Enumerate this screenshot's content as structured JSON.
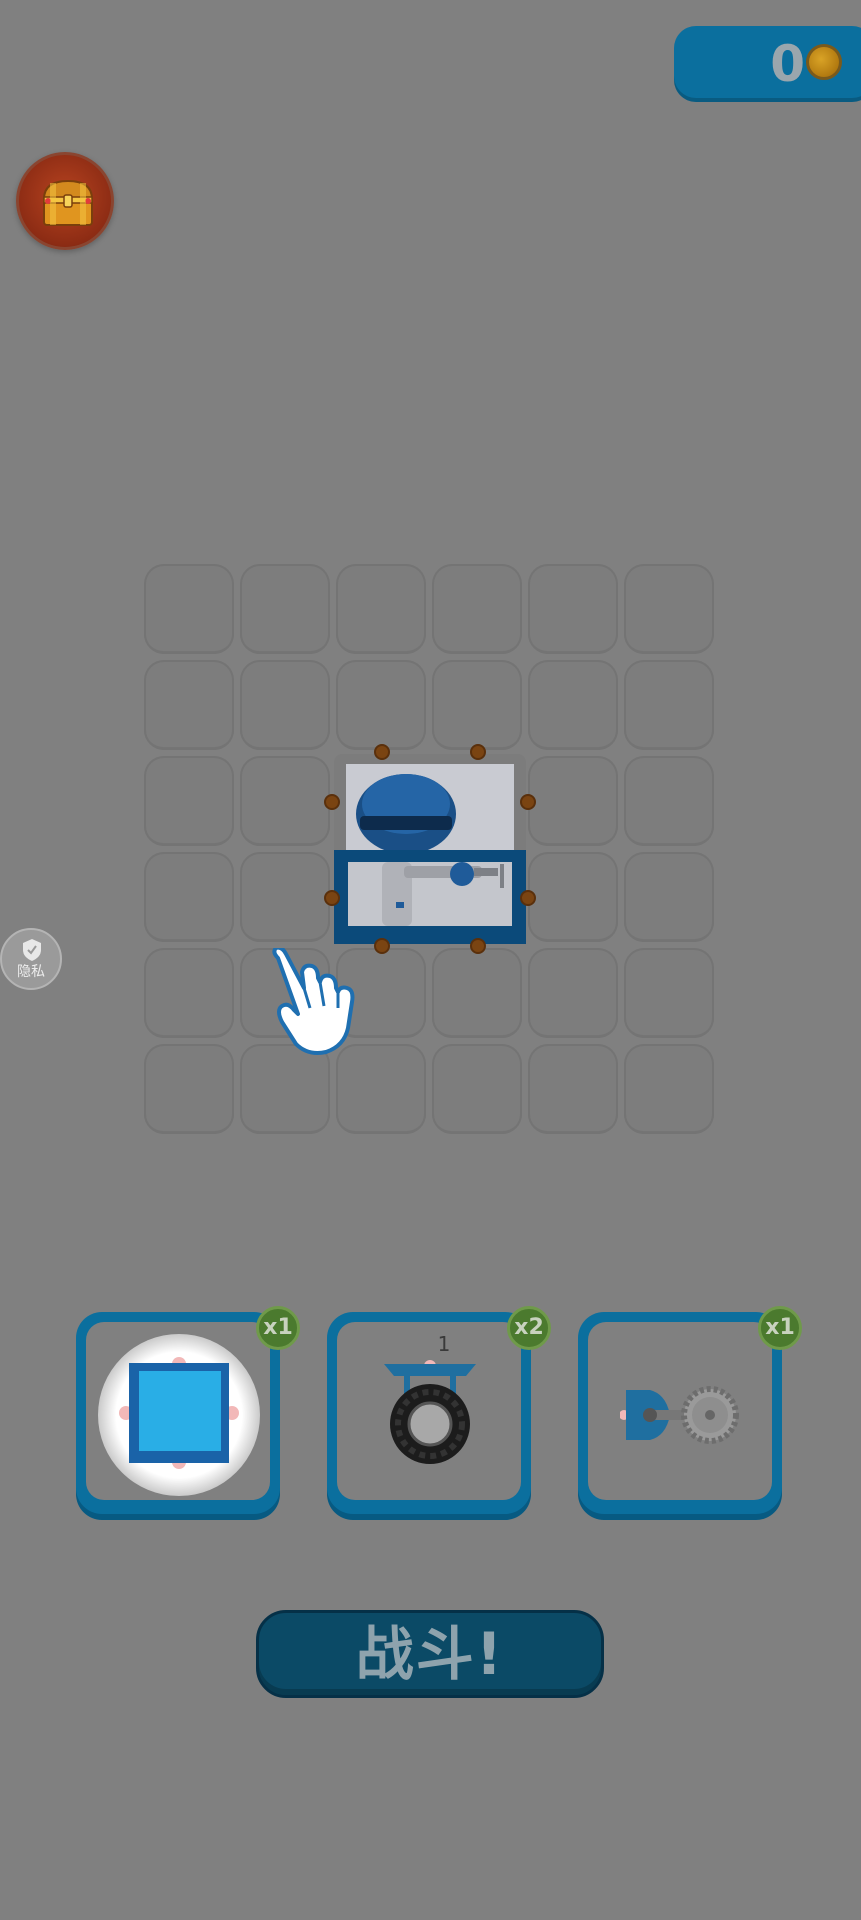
{
  "hud": {
    "coins": "0",
    "coin_icon": "gold-coin-icon",
    "chest_icon": "treasure-chest-icon"
  },
  "privacy": {
    "label": "隐私",
    "icon": "shield-icon"
  },
  "build_grid": {
    "rows": 6,
    "cols": 6,
    "placed_part": "robot-core-frame"
  },
  "parts_tray": {
    "items": [
      {
        "name": "block",
        "count": "x1",
        "icon": "blue-block-icon",
        "selected": true
      },
      {
        "name": "wheel",
        "count": "x2",
        "level": "1",
        "icon": "wheel-icon"
      },
      {
        "name": "saw",
        "count": "x1",
        "icon": "circular-saw-icon"
      }
    ]
  },
  "fight_button": {
    "label": "战斗!"
  },
  "tutorial": {
    "icon": "pointing-hand-icon"
  },
  "colors": {
    "background": "#808080",
    "accent_blue": "#0b6f9e",
    "badge_green": "#4b7a2e",
    "button_dark": "#0b4a66"
  }
}
